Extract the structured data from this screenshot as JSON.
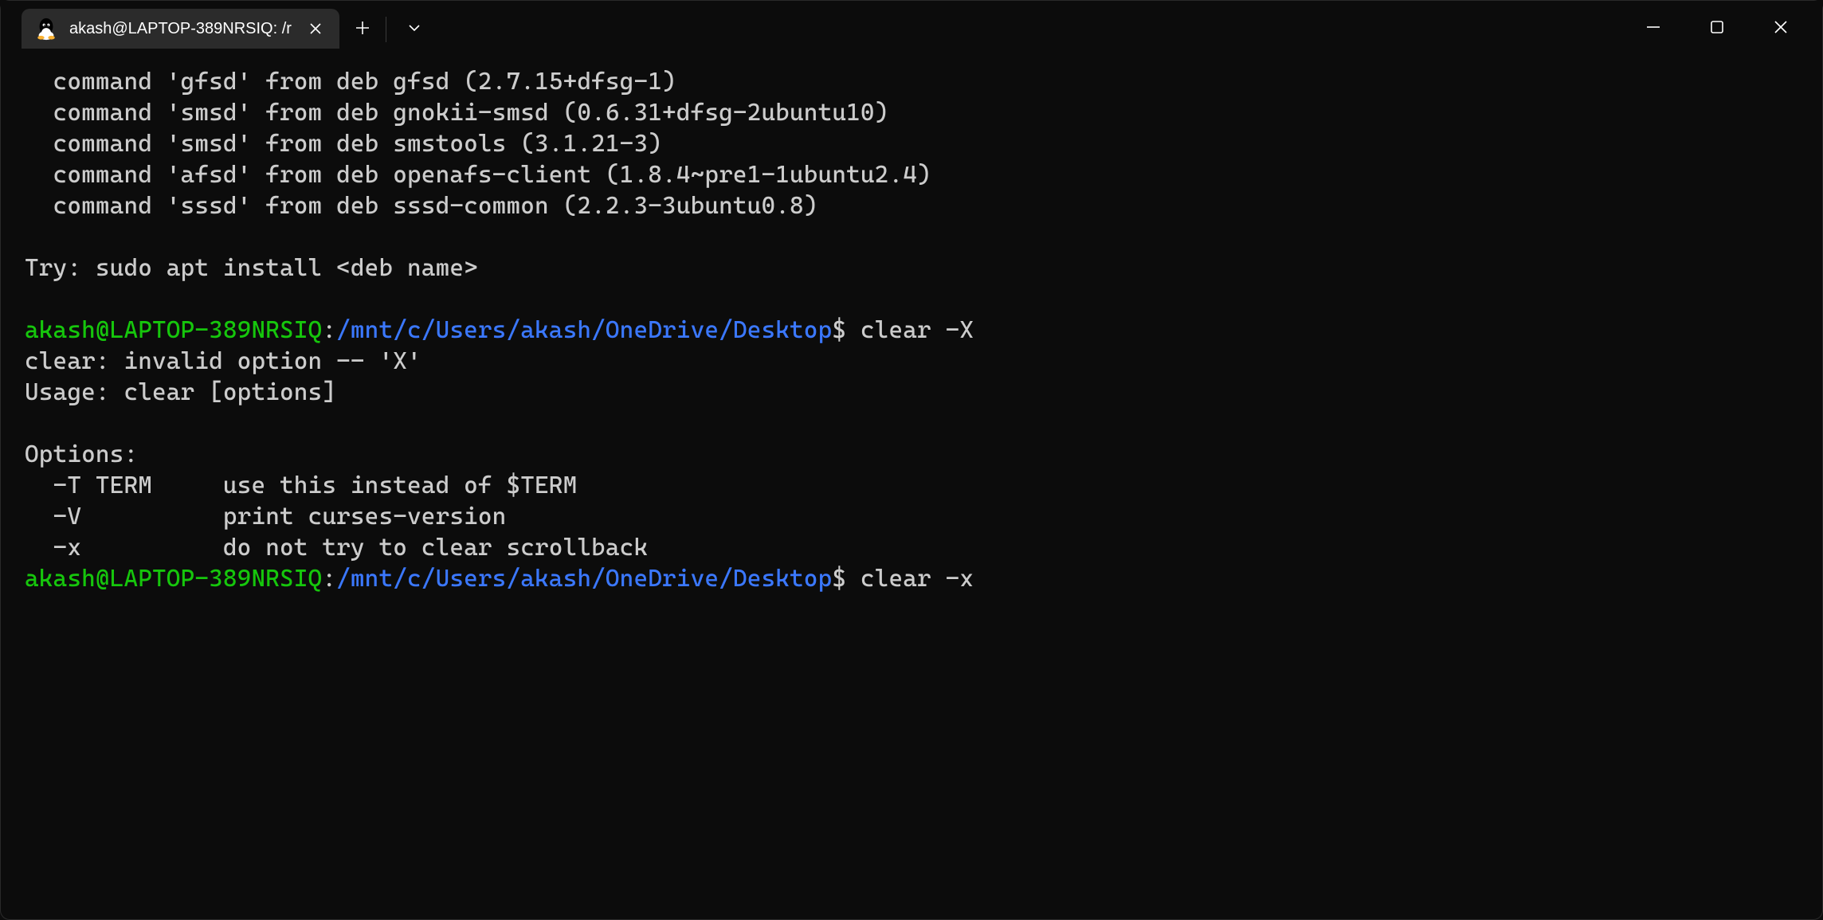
{
  "tab": {
    "title": "akash@LAPTOP-389NRSIQ: /r"
  },
  "terminal": {
    "lines": [
      "  command 'gfsd' from deb gfsd (2.7.15+dfsg-1)",
      "  command 'smsd' from deb gnokii-smsd (0.6.31+dfsg-2ubuntu10)",
      "  command 'smsd' from deb smstools (3.1.21-3)",
      "  command 'afsd' from deb openafs-client (1.8.4~pre1-1ubuntu2.4)",
      "  command 'sssd' from deb sssd-common (2.2.3-3ubuntu0.8)",
      "",
      "Try: sudo apt install <deb name>",
      ""
    ],
    "prompts": [
      {
        "userhost": "akash@LAPTOP-389NRSIQ",
        "colon": ":",
        "path": "/mnt/c/Users/akash/OneDrive/Desktop",
        "dollar": "$ ",
        "cmd": "clear -X"
      },
      {
        "userhost": "akash@LAPTOP-389NRSIQ",
        "colon": ":",
        "path": "/mnt/c/Users/akash/OneDrive/Desktop",
        "dollar": "$ ",
        "cmd": "clear -x"
      }
    ],
    "mid": [
      "clear: invalid option -- 'X'",
      "Usage: clear [options]",
      "",
      "Options:",
      "  -T TERM     use this instead of $TERM",
      "  -V          print curses-version",
      "  -x          do not try to clear scrollback"
    ]
  }
}
